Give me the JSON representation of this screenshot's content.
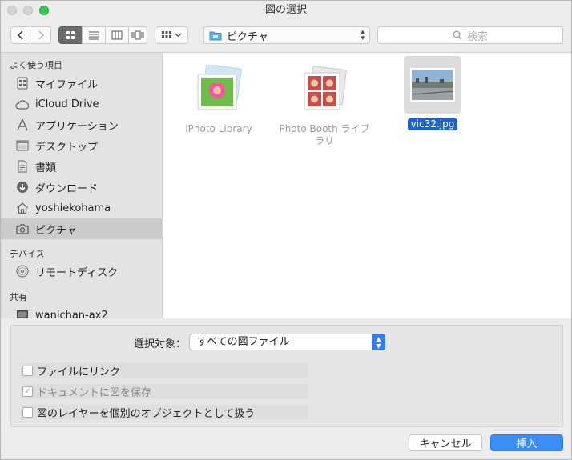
{
  "window": {
    "title": "図の選択"
  },
  "toolbar": {
    "location": "ピクチャ",
    "search_placeholder": "検索"
  },
  "sidebar": {
    "sections": [
      {
        "heading": "よく使う項目",
        "items": [
          {
            "label": "マイファイル",
            "icon": "all-my-files-icon"
          },
          {
            "label": "iCloud Drive",
            "icon": "cloud-icon"
          },
          {
            "label": "アプリケーション",
            "icon": "applications-icon"
          },
          {
            "label": "デスクトップ",
            "icon": "desktop-icon"
          },
          {
            "label": "書類",
            "icon": "documents-icon"
          },
          {
            "label": "ダウンロード",
            "icon": "downloads-icon"
          },
          {
            "label": "yoshiekohama",
            "icon": "home-icon"
          },
          {
            "label": "ピクチャ",
            "icon": "camera-icon",
            "selected": true
          }
        ]
      },
      {
        "heading": "デバイス",
        "items": [
          {
            "label": "リモートディスク",
            "icon": "disc-icon"
          }
        ]
      },
      {
        "heading": "共有",
        "items": [
          {
            "label": "wanichan-ax2",
            "icon": "computer-icon"
          }
        ]
      }
    ]
  },
  "files": [
    {
      "name": "iPhoto Library",
      "icon": "iphoto-library-icon"
    },
    {
      "name": "Photo Booth ライブラリ",
      "icon": "photo-booth-library-icon"
    },
    {
      "name": "vic32.jpg",
      "icon": "image-thumbnail",
      "selected": true
    }
  ],
  "options": {
    "filter_label": "選択対象：",
    "filter_value": "すべての図ファイル",
    "link_to_file": "ファイルにリンク",
    "save_with_document": "ドキュメントに図を保存",
    "save_with_document_checked": true,
    "separate_layers": "図のレイヤーを個別のオブジェクトとして扱う"
  },
  "buttons": {
    "cancel": "キャンセル",
    "insert": "挿入"
  },
  "colors": {
    "accent": "#3b8ef6",
    "selection": "#1b61d6",
    "zoom": "#34c84a"
  }
}
